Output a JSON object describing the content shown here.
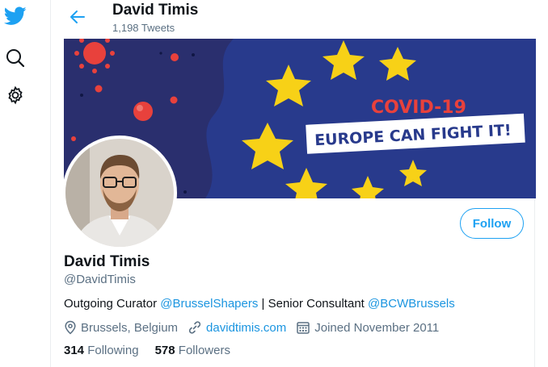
{
  "colors": {
    "accent": "#1da1f2",
    "link": "#1b95e0",
    "banner_bg": "#283a8c",
    "star": "#f7d117",
    "virus": "#e8413c"
  },
  "sidebar": {
    "icons": [
      "twitter-bird-icon",
      "search-icon",
      "settings-gear-icon"
    ]
  },
  "header": {
    "name": "David Timis",
    "tweet_count": "1,198 Tweets"
  },
  "banner": {
    "headline": "COVID-19",
    "slogan": "EUROPE CAN FIGHT IT!"
  },
  "profile": {
    "name": "David Timis",
    "handle": "@DavidTimis",
    "follow_label": "Follow",
    "bio": {
      "prefix": "Outgoing Curator ",
      "mention1": "@BrusselShapers",
      "middle": " | Senior Consultant ",
      "mention2": "@BCWBrussels"
    },
    "location": "Brussels, Belgium",
    "website": "davidtimis.com",
    "joined": "Joined November 2011"
  },
  "stats": {
    "following_count": "314",
    "following_label": "Following",
    "followers_count": "578",
    "followers_label": "Followers"
  }
}
